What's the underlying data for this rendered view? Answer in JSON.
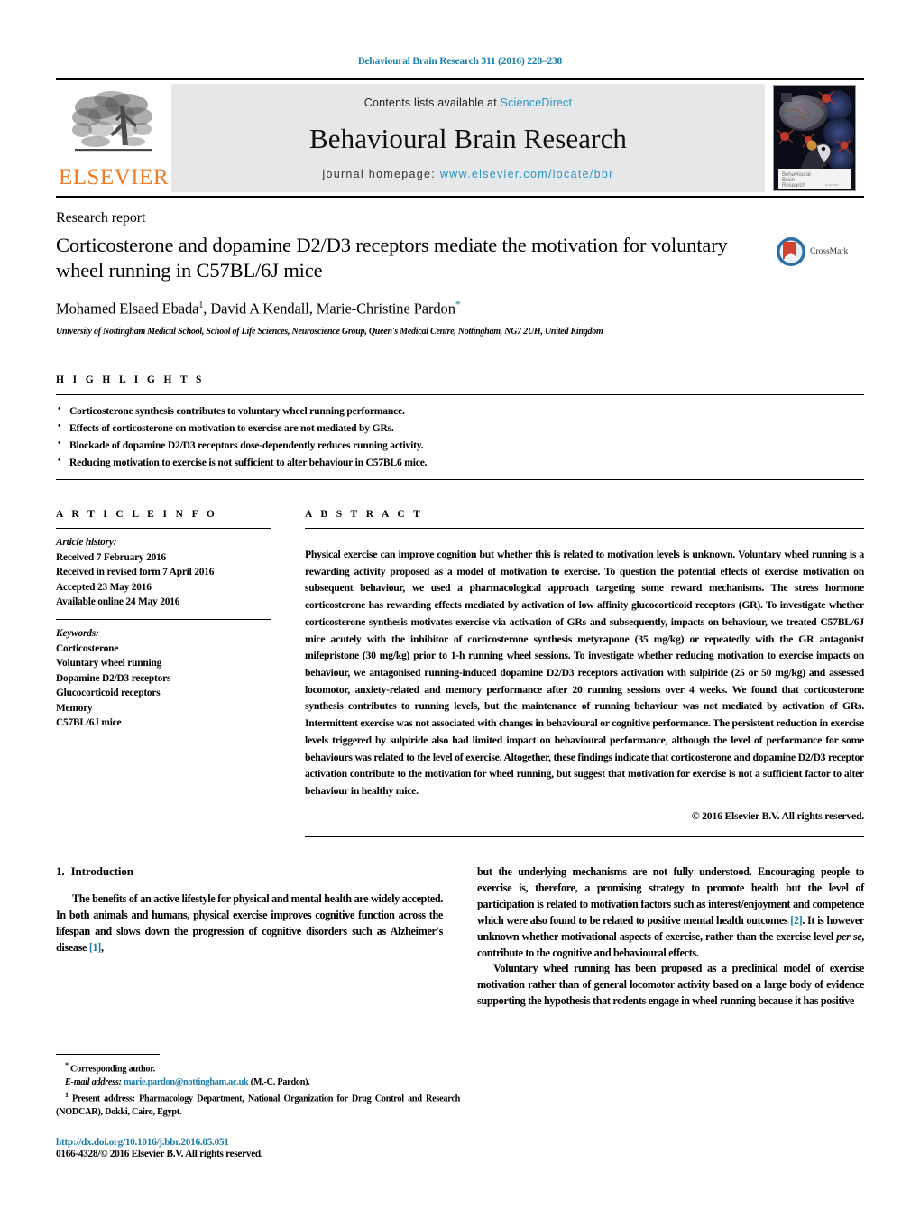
{
  "running_head": "Behavioural Brain Research 311 (2016) 228–238",
  "masthead": {
    "publisher_name": "ELSEVIER",
    "contents_prefix": "Contents lists available at",
    "contents_link": "ScienceDirect",
    "journal_title": "Behavioural Brain Research",
    "homepage_prefix": "journal homepage:",
    "homepage_url": "www.elsevier.com/locate/bbr",
    "cover_title_line1": "Behavioural",
    "cover_title_line2": "Brain",
    "cover_title_line3": "Research"
  },
  "article": {
    "type": "Research report",
    "title": "Corticosterone and dopamine D2/D3 receptors mediate the motivation for voluntary wheel running in C57BL/6J mice",
    "authors_pre": "Mohamed Elsaed Ebada",
    "author_sup1": "1",
    "authors_mid": ", David A Kendall, Marie-Christine Pardon",
    "author_star": "*",
    "affiliation": "University of Nottingham Medical School, School of Life Sciences, Neuroscience Group, Queen's Medical Centre, Nottingham, NG7 2UH, United Kingdom",
    "crossmark_label": "CrossMark"
  },
  "highlights": {
    "heading": "H I G H L I G H T S",
    "items": [
      "Corticosterone synthesis contributes to voluntary wheel running performance.",
      "Effects of corticosterone on motivation to exercise are not mediated by GRs.",
      "Blockade of dopamine D2/D3 receptors dose-dependently reduces running activity.",
      "Reducing motivation to exercise is not sufficient to alter behaviour in C57BL6 mice."
    ]
  },
  "article_info": {
    "heading": "A R T I C L E    I N F O",
    "history_label": "Article history:",
    "history": [
      "Received 7 February 2016",
      "Received in revised form 7 April 2016",
      "Accepted 23 May 2016",
      "Available online 24 May 2016"
    ],
    "keywords_label": "Keywords:",
    "keywords": [
      "Corticosterone",
      "Voluntary wheel running",
      "Dopamine D2/D3 receptors",
      "Glucocorticoid receptors",
      "Memory",
      "C57BL/6J mice"
    ]
  },
  "abstract": {
    "heading": "A B S T R A C T",
    "text": "Physical exercise can improve cognition but whether this is related to motivation levels is unknown. Voluntary wheel running is a rewarding activity proposed as a model of motivation to exercise. To question the potential effects of exercise motivation on subsequent behaviour, we used a pharmacological approach targeting some reward mechanisms. The stress hormone corticosterone has rewarding effects mediated by activation of low affinity glucocorticoid receptors (GR). To investigate whether corticosterone synthesis motivates exercise via activation of GRs and subsequently, impacts on behaviour, we treated C57BL/6J mice acutely with the inhibitor of corticosterone synthesis metyrapone (35 mg/kg) or repeatedly with the GR antagonist mifepristone (30 mg/kg) prior to 1-h running wheel sessions. To investigate whether reducing motivation to exercise impacts on behaviour, we antagonised running-induced dopamine D2/D3 receptors activation with sulpiride (25 or 50 mg/kg) and assessed locomotor, anxiety-related and memory performance after 20 running sessions over 4 weeks. We found that corticosterone synthesis contributes to running levels, but the maintenance of running behaviour was not mediated by activation of GRs. Intermittent exercise was not associated with changes in behavioural or cognitive performance. The persistent reduction in exercise levels triggered by sulpiride also had limited impact on behavioural performance, although the level of performance for some behaviours was related to the level of exercise. Altogether, these findings indicate that corticosterone and dopamine D2/D3 receptor activation contribute to the motivation for wheel running, but suggest that motivation for exercise is not a sufficient factor to alter behaviour in healthy mice.",
    "copyright": "© 2016 Elsevier B.V. All rights reserved."
  },
  "introduction": {
    "number": "1.",
    "heading": "Introduction",
    "left_paragraph_a": "The benefits of an active lifestyle for physical and mental health are widely accepted. In both animals and humans, physical exercise improves cognitive function across the lifespan and slows down the progression of cognitive disorders such as Alzheimer's disease ",
    "left_ref_1": "[1]",
    "left_paragraph_a_end": ",",
    "right_paragraph_a_start": "but the underlying mechanisms are not fully understood. Encouraging people to exercise is, therefore, a promising strategy to promote health but the level of participation is related to motivation factors such as interest/enjoyment and competence which were also found to be related to positive mental health outcomes ",
    "right_ref_2": "[2]",
    "right_paragraph_a_mid": ". It is however unknown whether motivational aspects of exercise, rather than the exercise level ",
    "right_per_se": "per se",
    "right_paragraph_a_end": ", contribute to the cognitive and behavioural effects.",
    "right_paragraph_b": "Voluntary wheel running has been proposed as a preclinical model of exercise motivation rather than of general locomotor activity based on a large body of evidence supporting the hypothesis that rodents engage in wheel running because it has positive"
  },
  "footnotes": {
    "corresponding_marker": "*",
    "corresponding_text": "Corresponding author.",
    "email_label": "E-mail address:",
    "email": "marie.pardon@nottingham.ac.uk",
    "email_suffix": "(M.-C. Pardon).",
    "present_marker": "1",
    "present_address": "Present address: Pharmacology Department, National Organization for Drug Control and Research (NODCAR), Dokki, Cairo, Egypt.",
    "doi": "http://dx.doi.org/10.1016/j.bbr.2016.05.051",
    "issn": "0166-4328/© 2016 Elsevier B.V. All rights reserved."
  },
  "colors": {
    "link_blue": "#1a7fa8",
    "sciencedirect_blue": "#2b95c4",
    "elsevier_orange": "#ec7c26",
    "masthead_gray": "#e6e7e8"
  }
}
